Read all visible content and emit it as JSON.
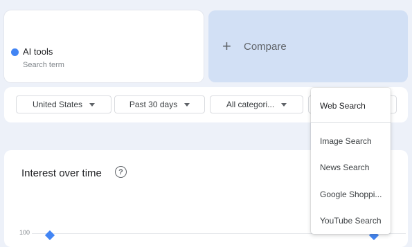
{
  "term": {
    "name": "AI tools",
    "sub": "Search term",
    "color": "#4285f4"
  },
  "compare": {
    "plus": "+",
    "label": "Compare"
  },
  "filters": {
    "region": "United States",
    "time": "Past 30 days",
    "category": "All categori..."
  },
  "dropdown": {
    "selected": "Web Search",
    "items": [
      "Image Search",
      "News Search",
      "Google Shoppi...",
      "YouTube Search"
    ]
  },
  "chart": {
    "title": "Interest over time",
    "help": "?",
    "y_top_label": "100"
  }
}
